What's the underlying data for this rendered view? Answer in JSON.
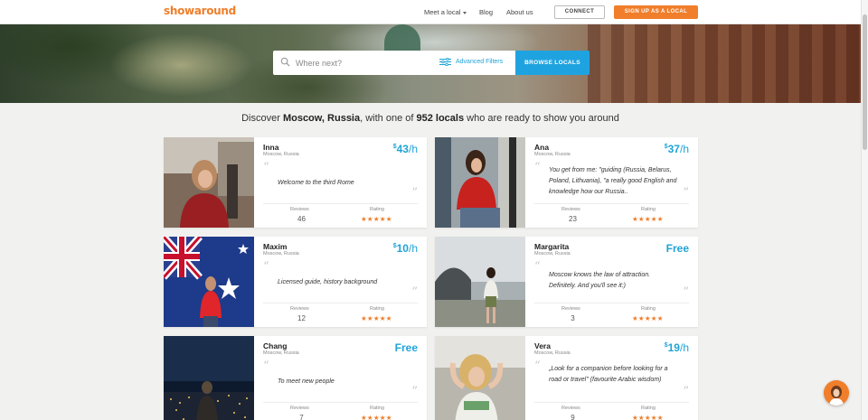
{
  "header": {
    "logo": "showaround",
    "nav": {
      "meet": "Meet a local",
      "blog": "Blog",
      "about": "About us"
    },
    "connect": "CONNECT",
    "signup": "SIGN UP AS A LOCAL"
  },
  "search": {
    "placeholder": "Where next?",
    "filters": "Advanced Filters",
    "browse": "BROWSE LOCALS"
  },
  "headline": {
    "prefix": "Discover ",
    "city": "Moscow, Russia",
    "mid": ", with one of ",
    "count": "952 locals",
    "suffix": " who are ready to show you around"
  },
  "card_labels": {
    "reviews": "Reviews",
    "rating": "Rating"
  },
  "cards": [
    {
      "name": "Inna",
      "location": "Moscow, Russia",
      "price_currency": "$",
      "price_amount": "43",
      "price_unit": "/h",
      "quote": "Welcome to the third Rome",
      "reviews": "46",
      "stars": "★★★★★",
      "rating_value": 5
    },
    {
      "name": "Ana",
      "location": "Moscow, Russia",
      "price_currency": "$",
      "price_amount": "37",
      "price_unit": "/h",
      "quote": "You get from me: \"guiding (Russia, Belarus, Poland, Lithuania), \"a really good English and knowledge how our Russia..",
      "reviews": "23",
      "stars": "★★★★★",
      "rating_value": 5
    },
    {
      "name": "Maxim",
      "location": "Moscow, Russia",
      "price_currency": "$",
      "price_amount": "10",
      "price_unit": "/h",
      "quote": "Licensed guide, history background",
      "reviews": "12",
      "stars": "★★★★★",
      "rating_value": 5
    },
    {
      "name": "Margarita",
      "location": "Moscow, Russia",
      "price_free": "Free",
      "quote": "Moscow knows the law of attraction. Definitely. And you'll see it:)",
      "reviews": "3",
      "stars": "★★★★★",
      "rating_value": 5
    },
    {
      "name": "Chang",
      "location": "Moscow, Russia",
      "price_free": "Free",
      "quote": "To meet new people",
      "reviews": "7",
      "stars": "★★★★★",
      "rating_value": 5
    },
    {
      "name": "Vera",
      "location": "Moscow, Russia",
      "price_currency": "$",
      "price_amount": "19",
      "price_unit": "/h",
      "quote": "„Look for a companion before looking for a road or travel\" (favourite Arabic wisdom)",
      "reviews": "9",
      "stars": "★★★★★",
      "rating_value": 5
    }
  ],
  "colors": {
    "brand_orange": "#f07e2b",
    "accent_blue": "#1fa3d8"
  }
}
